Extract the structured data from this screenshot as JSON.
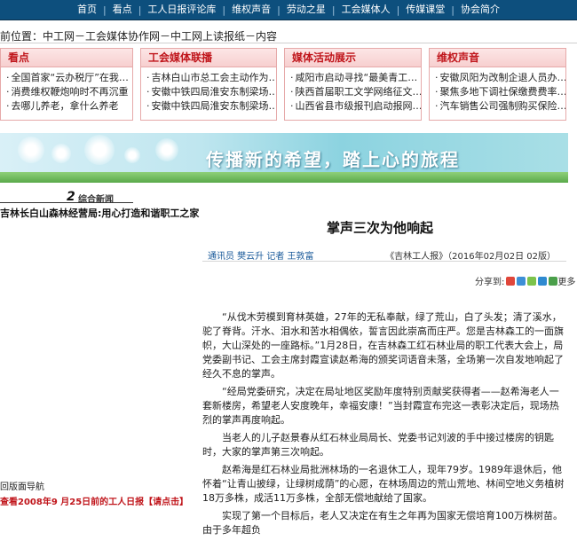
{
  "topnav": [
    "首页",
    "看点",
    "工人日报评论库",
    "维权声音",
    "劳动之星",
    "工会媒体人",
    "传媒课堂",
    "协会简介"
  ],
  "breadcrumb": "前位置：中工网－工会媒体协作网－中工网上读报纸－内容",
  "boxes": [
    {
      "title": "看点",
      "items": [
        "全国首家“云办税厅”在我…",
        "消费维权鞭炮响时不再沉重",
        "去哪儿养老，拿什么养老"
      ]
    },
    {
      "title": "工会媒体联播",
      "items": [
        "吉林白山市总工会主动作为…",
        "安徽中铁四局淮安东制梁场…",
        "安徽中铁四局淮安东制梁场…"
      ]
    },
    {
      "title": "媒体活动展示",
      "items": [
        "咸阳市启动寻找“最美青工…",
        "陕西首届职工文学网络征文…",
        "山西省县市级报刊启动报网…"
      ]
    },
    {
      "title": "维权声音",
      "items": [
        "安徽凤阳为改制企退人员办…",
        "聚焦多地下调社保缴费费率…",
        "汽车销售公司强制购买保险…"
      ]
    }
  ],
  "banner": {
    "slogan": "传播新的希望，踏上心的旅程"
  },
  "thumb": {
    "tag": "综合新闻",
    "number": "2",
    "title": "吉林长白山森林经营局:用心打造和谐职工之家"
  },
  "article": {
    "title": "掌声三次为他响起",
    "author": "通讯员 樊云升 记者 王敦富",
    "source": "《吉林工人报》（2016年02月02日 02版）",
    "share_label": "分享到:",
    "share_more": "更多",
    "paragraphs": [
      "“从伐木劳模到育林英雄，27年的无私奉献，绿了荒山，白了头发；清了溪水，驼了脊背。汗水、泪水和苦水相偶依，誓言因此崇高而庄严。您是吉林森工的一面旗帜，大山深处的一座路标。”1月28日，在吉林森工红石林业局的职工代表大会上，局党委副书记、工会主席封霞宣读赵希海的颁奖词语音未落，全场第一次自发地响起了经久不息的掌声。",
      "“经局党委研究，决定在局址地区奖励年度特别贡献奖获得者——赵希海老人一套新楼房，希望老人安度晚年，幸福安康！”当封霞宣布完这一表彰决定后，现场热烈的掌声再度响起。",
      "当老人的儿子赵景春从红石林业局局长、党委书记刘波的手中接过楼房的钥匙时，大家的掌声第三次响起。",
      "赵希海是红石林业局批洲林场的一名退休工人，现年79岁。1989年退休后，他怀着“让青山披绿，让绿树成荫”的心愿，在林场周边的荒山荒地、林间空地义务植树18万多株，成活11万多株，全部无偿地献给了国家。",
      "实现了第一个目标后，老人又决定在有生之年再为国家无偿培育100万株树苗。由于多年超负"
    ]
  },
  "left": {
    "nav": "回版面导航",
    "history": "查看2008年9  月25日前的工人日报【请点击】"
  }
}
